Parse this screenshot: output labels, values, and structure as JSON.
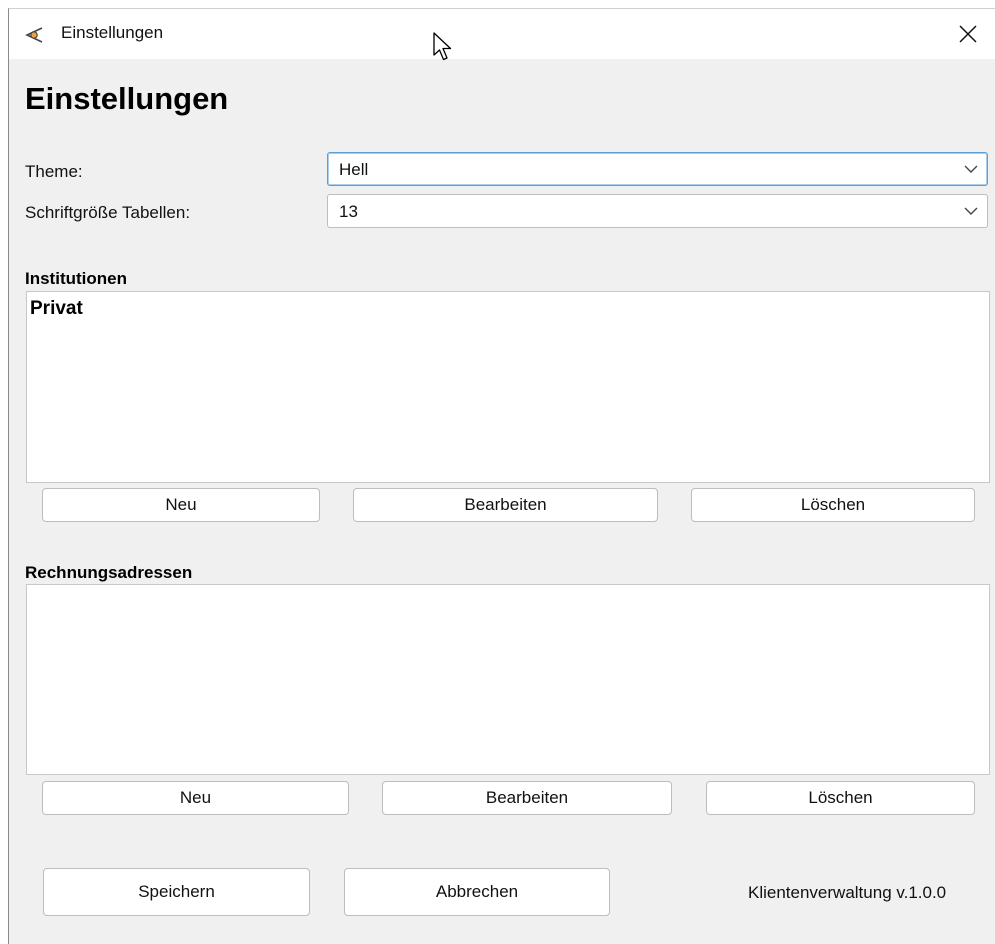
{
  "window": {
    "title": "Einstellungen"
  },
  "page": {
    "heading": "Einstellungen"
  },
  "settings": {
    "theme_label": "Theme:",
    "theme_value": "Hell",
    "font_size_label": "Schriftgröße Tabellen:",
    "font_size_value": "13"
  },
  "institutions": {
    "title": "Institutionen",
    "items": [
      "Privat"
    ],
    "new_label": "Neu",
    "edit_label": "Bearbeiten",
    "delete_label": "Löschen"
  },
  "billing_addresses": {
    "title": "Rechnungsadressen",
    "items": [],
    "new_label": "Neu",
    "edit_label": "Bearbeiten",
    "delete_label": "Löschen"
  },
  "footer": {
    "save_label": "Speichern",
    "cancel_label": "Abbrechen",
    "version": "Klientenverwaltung v.1.0.0"
  },
  "colors": {
    "window_bg": "#f0f0f0",
    "focus_border": "#5a9fd6",
    "icon_accent": "#e8a33c"
  }
}
